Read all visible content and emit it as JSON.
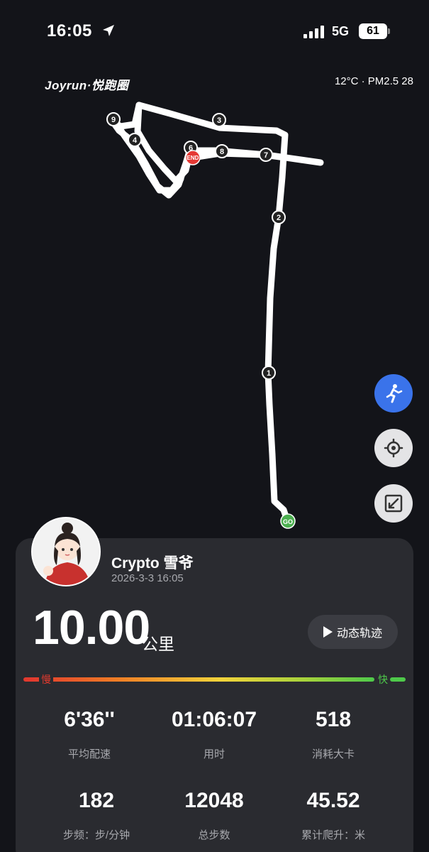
{
  "status_bar": {
    "time": "16:05",
    "network": "5G",
    "battery": "61"
  },
  "header": {
    "brand": "Joyrun·悦跑圈",
    "weather": "12°C · PM2.5 28"
  },
  "map": {
    "route_color": "#ffffff",
    "start_label": "GO",
    "start_color": "#4caf50",
    "end_label": "END",
    "end_color": "#e53935",
    "km_markers": [
      "1",
      "2",
      "3",
      "4",
      "6",
      "7",
      "8",
      "9"
    ]
  },
  "controls": {
    "runner_icon": "runner-icon",
    "locate_icon": "crosshair-icon",
    "expand_icon": "expand-icon",
    "accent": "#3a73ea"
  },
  "user": {
    "name": "Crypto 雪爷",
    "datetime": "2026-3-3 16:05"
  },
  "summary": {
    "distance": "10.00",
    "distance_unit": "公里",
    "replay_label": "动态轨迹"
  },
  "pace_scale": {
    "slow_label": "慢",
    "fast_label": "快"
  },
  "stats": [
    {
      "value": "6'36''",
      "label": "平均配速"
    },
    {
      "value": "01:06:07",
      "label": "用时"
    },
    {
      "value": "518",
      "label": "消耗大卡"
    },
    {
      "value": "182",
      "label": "步频：步/分钟"
    },
    {
      "value": "12048",
      "label": "总步数"
    },
    {
      "value": "45.52",
      "label": "累计爬升：米"
    }
  ]
}
